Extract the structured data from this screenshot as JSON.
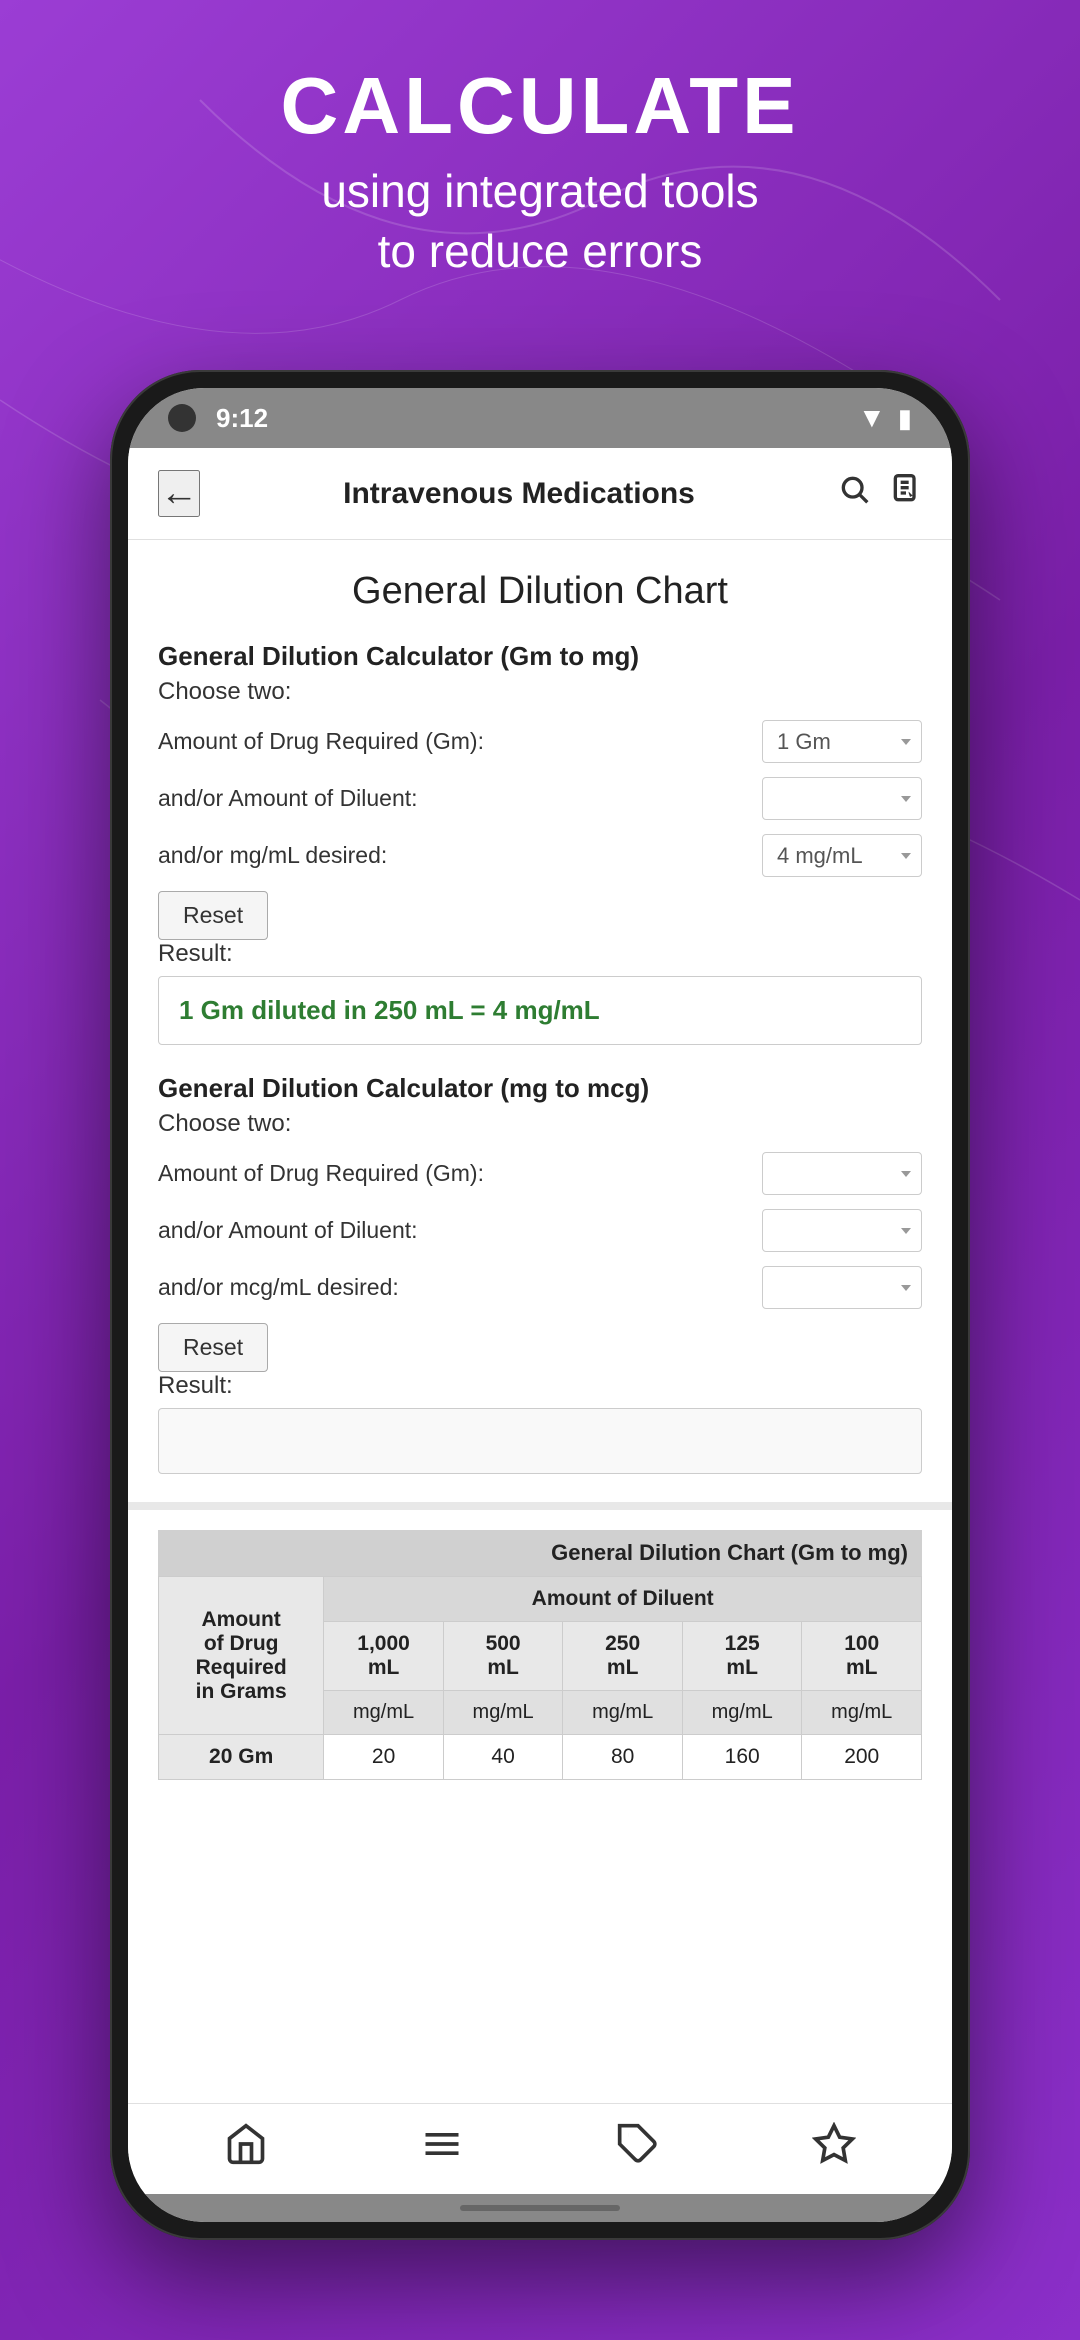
{
  "background": {
    "color": "#8B2FC9"
  },
  "header": {
    "line1": "CALCULATE",
    "line2": "using integrated tools",
    "line3": "to reduce errors"
  },
  "status_bar": {
    "time": "9:12"
  },
  "app_header": {
    "back_label": "←",
    "title": "Intravenous Medications",
    "search_icon": "search",
    "notes_icon": "notes"
  },
  "page": {
    "title": "General Dilution Chart",
    "calc1": {
      "title": "General Dilution Calculator (Gm to mg)",
      "subtitle": "Choose two:",
      "field1_label": "Amount of Drug Required (Gm):",
      "field1_value": "1 Gm",
      "field2_label": "and/or Amount of Diluent:",
      "field2_value": "",
      "field3_label": "and/or mg/mL desired:",
      "field3_value": "4 mg/mL",
      "reset_label": "Reset",
      "result_label": "Result:",
      "result_value": "1 Gm diluted in 250 mL = 4 mg/mL"
    },
    "calc2": {
      "title": "General Dilution Calculator (mg to mcg)",
      "subtitle": "Choose two:",
      "field1_label": "Amount of Drug Required (Gm):",
      "field1_value": "",
      "field2_label": "and/or Amount of Diluent:",
      "field2_value": "",
      "field3_label": "and/or mcg/mL desired:",
      "field3_value": "",
      "reset_label": "Reset",
      "result_label": "Result:",
      "result_value": ""
    },
    "table": {
      "section_title": "General Dilution Chart (Gm to mg)",
      "col_header_drug": "Amount\nof Drug\nRequired\nin Grams",
      "col_header_diluent": "Amount of Diluent",
      "sub_cols": [
        "1,000\nmL",
        "500\nmL",
        "250\nmL",
        "125\nmL",
        "100\nmL"
      ],
      "unit_row": [
        "",
        "mg/mL",
        "mg/mL",
        "mg/mL",
        "mg/mL",
        "mg/mL"
      ],
      "rows": [
        [
          "20 Gm",
          "20",
          "40",
          "80",
          "160",
          "200"
        ]
      ]
    }
  },
  "bottom_nav": {
    "home_icon": "🏠",
    "menu_icon": "☰",
    "tag_icon": "🏷",
    "star_icon": "☆"
  }
}
